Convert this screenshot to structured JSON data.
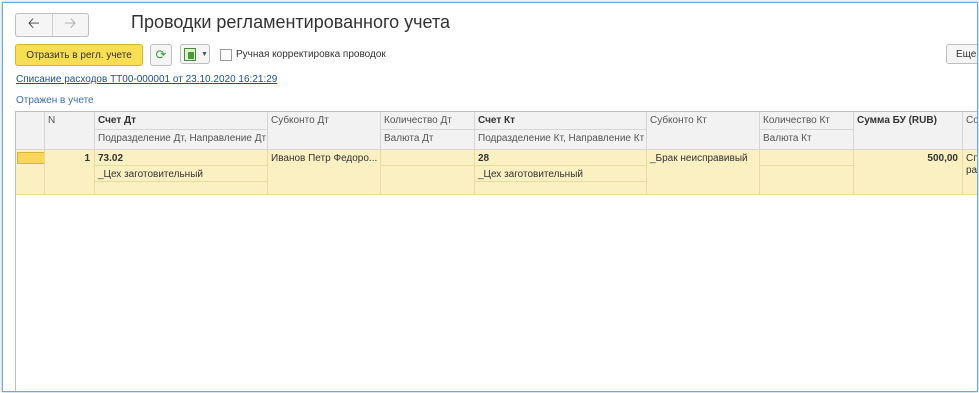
{
  "nav": {
    "back_icon": "arrow-left-icon",
    "forward_icon": "arrow-right-icon"
  },
  "page": {
    "title": "Проводки регламентированного учета"
  },
  "toolbar": {
    "post_label": "Отразить в регл. учете",
    "refresh_icon": "refresh-icon",
    "manual_label": "Ручная корректировка проводок",
    "more_label": "Еще"
  },
  "document_link": "Списание расходов ТТ00-000001 от 23.10.2020 16:21:29",
  "status": "Отражен в учете",
  "table": {
    "headers": {
      "marker": "",
      "n": "N",
      "debit_account": "Счет Дт",
      "debit_subconto": "Субконто Дт",
      "debit_qty": "Количество Дт",
      "credit_account": "Счет Кт",
      "credit_subconto": "Субконто Кт",
      "credit_qty": "Количество Кт",
      "amount": "Сумма БУ (RUB)",
      "content": "Сод",
      "debit_division": "Подразделение Дт, Направление Дт",
      "debit_currency": "Валюта Дт",
      "credit_division": "Подразделение Кт, Направление Кт",
      "credit_currency": "Валюта Кт"
    },
    "rows": [
      {
        "n": "1",
        "debit_account": "73.02",
        "debit_subconto": "Иванов Петр Федоро...",
        "debit_division": "_Цех заготовительный",
        "credit_account": "28",
        "credit_subconto": "_Брак неисправивый",
        "credit_division": "_Цех заготовительный",
        "amount": "500,00",
        "content_line1": "Спи",
        "content_line2": "рас"
      }
    ]
  },
  "colors": {
    "accent_button": "#f7de52",
    "selected_row": "#fbf0c2",
    "link": "#1a4f9e"
  }
}
